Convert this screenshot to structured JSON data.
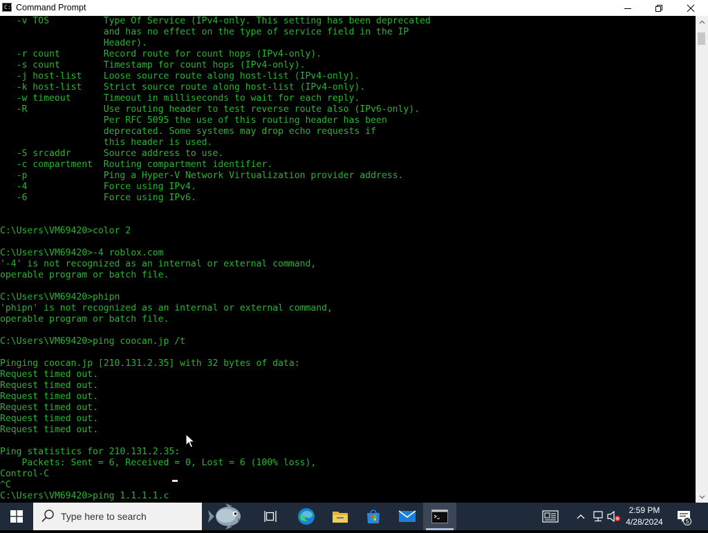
{
  "window": {
    "title": "Command Prompt",
    "app_icon_text": "C:\\",
    "minimize": "minimize",
    "maximize": "maximize",
    "close": "close"
  },
  "console": {
    "text_color": "#22b82c",
    "lines": [
      "   -v TOS          Type Of Service (IPv4-only. This setting has been deprecated",
      "                   and has no effect on the type of service field in the IP",
      "                   Header).",
      "   -r count        Record route for count hops (IPv4-only).",
      "   -s count        Timestamp for count hops (IPv4-only).",
      "   -j host-list    Loose source route along host-list (IPv4-only).",
      "   -k host-list    Strict source route along host-list (IPv4-only).",
      "   -w timeout      Timeout in milliseconds to wait for each reply.",
      "   -R              Use routing header to test reverse route also (IPv6-only).",
      "                   Per RFC 5095 the use of this routing header has been",
      "                   deprecated. Some systems may drop echo requests if",
      "                   this header is used.",
      "   -S srcaddr      Source address to use.",
      "   -c compartment  Routing compartment identifier.",
      "   -p              Ping a Hyper-V Network Virtualization provider address.",
      "   -4              Force using IPv4.",
      "   -6              Force using IPv6.",
      "",
      "",
      "C:\\Users\\VM69420>color 2",
      "",
      "C:\\Users\\VM69420>-4 roblox.com",
      "'-4' is not recognized as an internal or external command,",
      "operable program or batch file.",
      "",
      "C:\\Users\\VM69420>phipn",
      "'phipn' is not recognized as an internal or external command,",
      "operable program or batch file.",
      "",
      "C:\\Users\\VM69420>ping coocan.jp /t",
      "",
      "Pinging coocan.jp [210.131.2.35] with 32 bytes of data:",
      "Request timed out.",
      "Request timed out.",
      "Request timed out.",
      "Request timed out.",
      "Request timed out.",
      "Request timed out.",
      "",
      "Ping statistics for 210.131.2.35:",
      "    Packets: Sent = 6, Received = 0, Lost = 6 (100% loss),",
      "Control-C",
      "^C",
      "C:\\Users\\VM69420>ping 1.1.1.1.c"
    ]
  },
  "taskbar": {
    "search_placeholder": "Type here to search",
    "icons": [
      "windows-start-icon",
      "search-icon",
      "task-view-icon",
      "edge-icon",
      "file-explorer-icon",
      "microsoft-store-icon",
      "mail-icon",
      "command-prompt-icon"
    ],
    "tray_icons": [
      "news-icon",
      "show-hidden-icons-chevron",
      "network-icon",
      "volume-muted-icon"
    ],
    "time": "2:59 PM",
    "date": "4/28/2024",
    "notification_count": "5",
    "taskbar_color": "#1f2b3a"
  }
}
